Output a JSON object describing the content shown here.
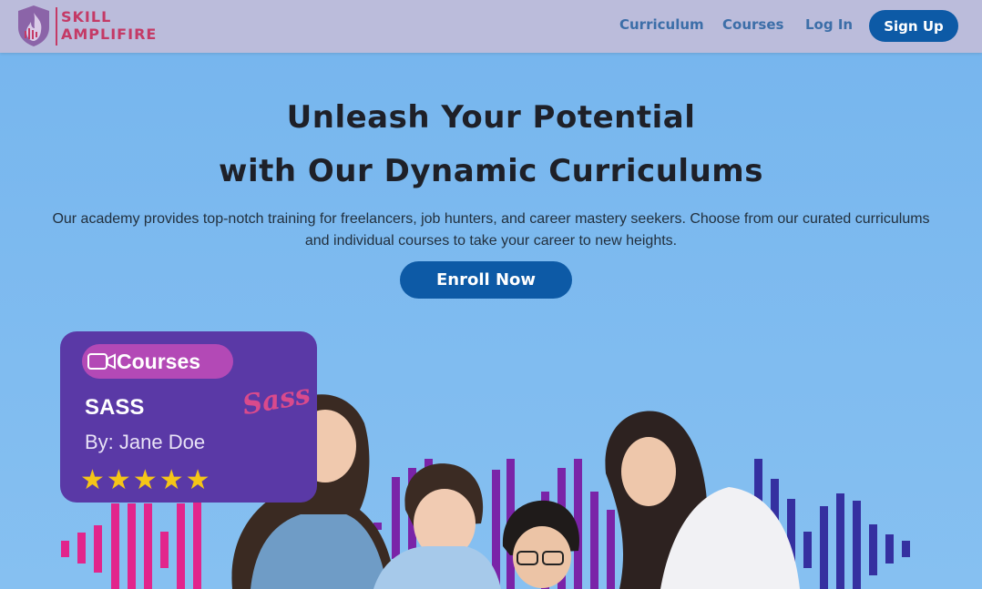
{
  "brand": {
    "line1": "SKILL",
    "line2": "AMPLIFIRE",
    "primary_color": "#c43a66",
    "icon": "flame-shield-icon"
  },
  "nav": {
    "links": [
      {
        "label": "Curriculum"
      },
      {
        "label": "Courses"
      },
      {
        "label": "Log In"
      }
    ],
    "signup_label": "Sign Up"
  },
  "hero": {
    "headline_line1": "Unleash Your Potential",
    "headline_line2": "with Our Dynamic Curriculums",
    "description": "Our academy provides top-notch training for freelancers, job hunters, and career mastery seekers. Choose from our curated curriculums and individual courses to take your career to new heights.",
    "cta_label": "Enroll Now"
  },
  "course_card": {
    "badge_label": "Courses",
    "badge_icon": "video-camera-icon",
    "title": "SASS",
    "author": "By: Jane Doe",
    "rating": 5,
    "rating_max": 5,
    "logo_text": "Sass"
  },
  "colors": {
    "nav_bg": "#bbbcdb",
    "hero_bg": "#83bdf0",
    "button": "#0d5aa6",
    "card": "#5a39a6",
    "badge": "#b349b6",
    "star": "#f5c517",
    "wave_pink": "#e2258c",
    "wave_purple": "#7a24a8",
    "wave_blue": "#3530a0"
  }
}
